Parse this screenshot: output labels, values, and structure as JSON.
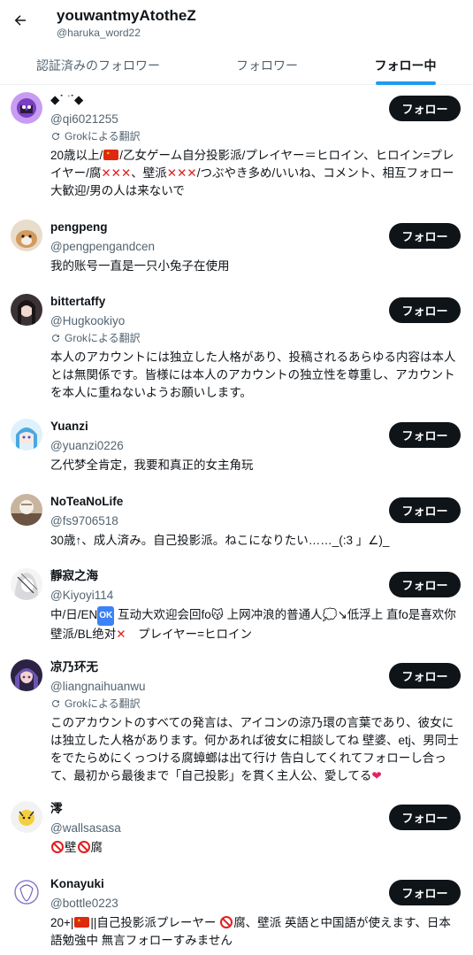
{
  "header": {
    "name": "youwantmyAtotheZ",
    "handle": "@haruka_word22"
  },
  "tabs": [
    {
      "label": "認証済みのフォロワー"
    },
    {
      "label": "フォロワー"
    },
    {
      "label": "フォロー中"
    }
  ],
  "translate_label": "Grokによる翻訳",
  "follow_label": "フォロー",
  "users": [
    {
      "name": "◆˙ ͘ ˙◆",
      "handle": "@qi6021255",
      "bio_parts": [
        "20歳以上/",
        "/乙女ゲーム自分投影派/プレイヤー＝ヒロイン、ヒロイン=プレイヤー/腐",
        "、壁派",
        "/つぶやき多め/いいね、コメント、相互フォロー大歓迎/男の人は来ないで"
      ],
      "avatar_color": "#b56ee8"
    },
    {
      "name": "pengpeng",
      "handle": "@pengpengandcen",
      "bio": "我的账号一直是一只小兔子在使用",
      "avatar_color": "#d9b48a"
    },
    {
      "name": "bittertaffy",
      "handle": "@Hugkookiyo",
      "bio": "本人のアカウントには独立した人格があり、投稿されるあらゆる内容は本人とは無関係です。皆様には本人のアカウントの独立性を尊重し、アカウントを本人に重ねないようお願いします。",
      "avatar_color": "#3a3234"
    },
    {
      "name": "Yuanzi",
      "handle": "@yuanzi0226",
      "bio": "乙代梦全肯定，我要和真正的女主角玩",
      "avatar_color": "#6fb9e8"
    },
    {
      "name": "NoTeaNoLife",
      "handle": "@fs9706518",
      "bio": "30歳↑、成人済み。自己投影派。ねこになりたい……_(:3 」∠)_",
      "avatar_color": "#8a7463"
    },
    {
      "name": "靜寂之海",
      "handle": "@Kiyoyi114",
      "bio_parts": [
        "中/日/EN",
        "OK",
        " 互动大欢迎会回fo",
        " 上网冲浪的普通人",
        "↘低浮上 直fo是喜欢你 壁派/BL绝对",
        "　プレイヤー=ヒロイン"
      ],
      "avatar_color": "#9a9aa0"
    },
    {
      "name": "凉乃环无",
      "handle": "@liangnaihuanwu",
      "bio_parts": [
        "このアカウントのすべての発言は、アイコンの涼乃環の言葉であり、彼女には独立した人格があります。何かあれば彼女に相談してね 壁婆、etj、男同士をでたらめにくっつける腐蟑螂は出て行け 告白してくれてフォローし合って、最初から最後まで「自己投影」を貫く主人公、愛してる"
      ],
      "avatar_color": "#5a4a8c"
    },
    {
      "name": "澪",
      "handle": "@wallsasasa",
      "bio_parts": [
        "壁",
        "腐"
      ],
      "avatar_color": "#f4d03f"
    },
    {
      "name": "Konayuki",
      "handle": "@bottle0223",
      "bio_parts": [
        "20+|",
        "||自己投影派プレーヤー ",
        "腐、壁派 英語と中国語が使えます、日本語勉強中 無言フォローすみません"
      ],
      "avatar_color": "#d8d4f0"
    }
  ]
}
